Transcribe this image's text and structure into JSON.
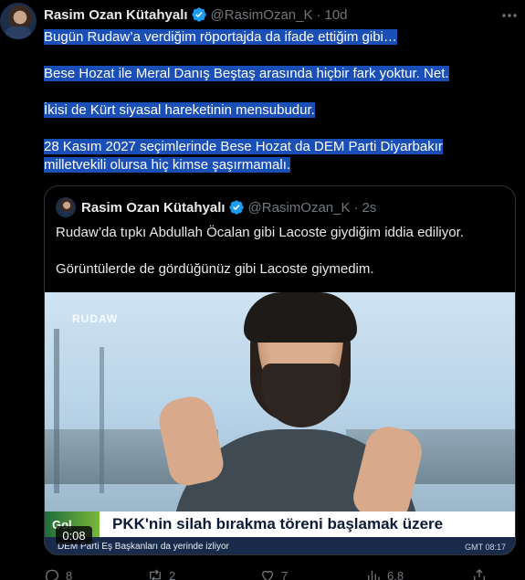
{
  "tweet": {
    "author_name": "Rasim Ozan Kütahyalı",
    "handle": "@RasimOzan_K",
    "separator": "·",
    "time": "10d",
    "paragraphs": [
      "Bugün Rudaw’a verdiğim röportajda da ifade ettiğim gibi…",
      "Bese Hozat ile Meral Danış Beştaş arasında hiçbir fark yoktur. Net.",
      "İkisi de Kürt siyasal hareketinin mensubudur.",
      "28 Kasım 2027 seçimlerinde Bese Hozat da DEM Parti Diyarbakır milletvekili olursa hiç kimse şaşırmamalı."
    ]
  },
  "quote": {
    "author_name": "Rasim Ozan Kütahyalı",
    "handle": "@RasimOzan_K",
    "separator": "·",
    "time": "2s",
    "paragraphs": [
      "Rudaw’da tıpkı Abdullah Öcalan gibi Lacoste giydiğim iddia ediliyor.",
      "Görüntülerde de gördüğünüz gibi Lacoste giymedim."
    ],
    "video": {
      "channel_logo": "RUDAW",
      "tag": "Gol",
      "headline": "PKK'nin silah bırakma töreni başlamak üzere",
      "ticker": "DEM Parti Eş Başkanları da yerinde izliyor",
      "ticker_time": "GMT 08:17",
      "duration": "0:08"
    }
  },
  "actions": {
    "replies": "8",
    "retweets": "2",
    "likes": "7",
    "views": "6,8"
  },
  "colors": {
    "background": "#000000",
    "selection": "#1a4fb8",
    "verified": "#1d9bf0",
    "muted": "#71767b"
  }
}
